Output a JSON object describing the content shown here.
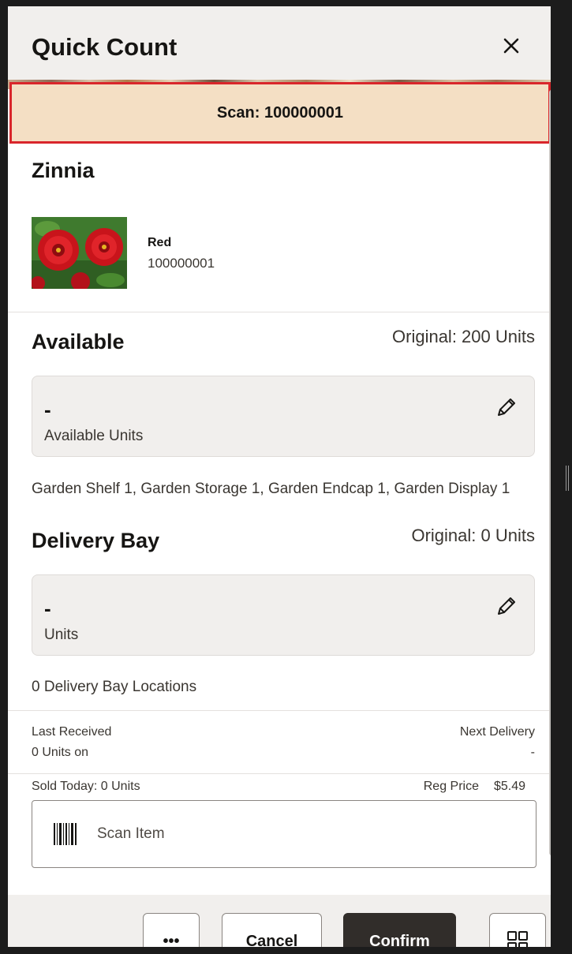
{
  "dialog": {
    "title": "Quick Count",
    "scan_banner": "Scan: 100000001"
  },
  "item": {
    "name": "Zinnia",
    "variant": "Red",
    "sku": "100000001"
  },
  "available": {
    "title": "Available",
    "original": "Original: 200 Units",
    "value": "-",
    "label": "Available Units",
    "locations": "Garden Shelf 1, Garden Storage 1, Garden Endcap 1, Garden Display 1"
  },
  "delivery_bay": {
    "title": "Delivery Bay",
    "original": "Original: 0 Units",
    "value": "-",
    "label": "Units",
    "locations": "0 Delivery Bay Locations"
  },
  "info": {
    "last_received_label": "Last Received",
    "last_received_value": "0 Units on",
    "next_delivery_label": "Next Delivery",
    "next_delivery_value": "-",
    "sold_today": "Sold Today: 0 Units",
    "reg_price_label": "Reg Price",
    "reg_price_value": "$5.49"
  },
  "scan_input": {
    "placeholder": "Scan Item"
  },
  "footer": {
    "more_label": "•••",
    "cancel_label": "Cancel",
    "confirm_label": "Confirm"
  },
  "colors": {
    "banner_bg": "#f4dfc4",
    "banner_border": "#d9262b",
    "confirm_bg": "#312d2a",
    "header_bg": "#f1efed"
  },
  "icons": [
    "close-icon",
    "pencil-icon",
    "barcode-icon",
    "grid-icon"
  ]
}
